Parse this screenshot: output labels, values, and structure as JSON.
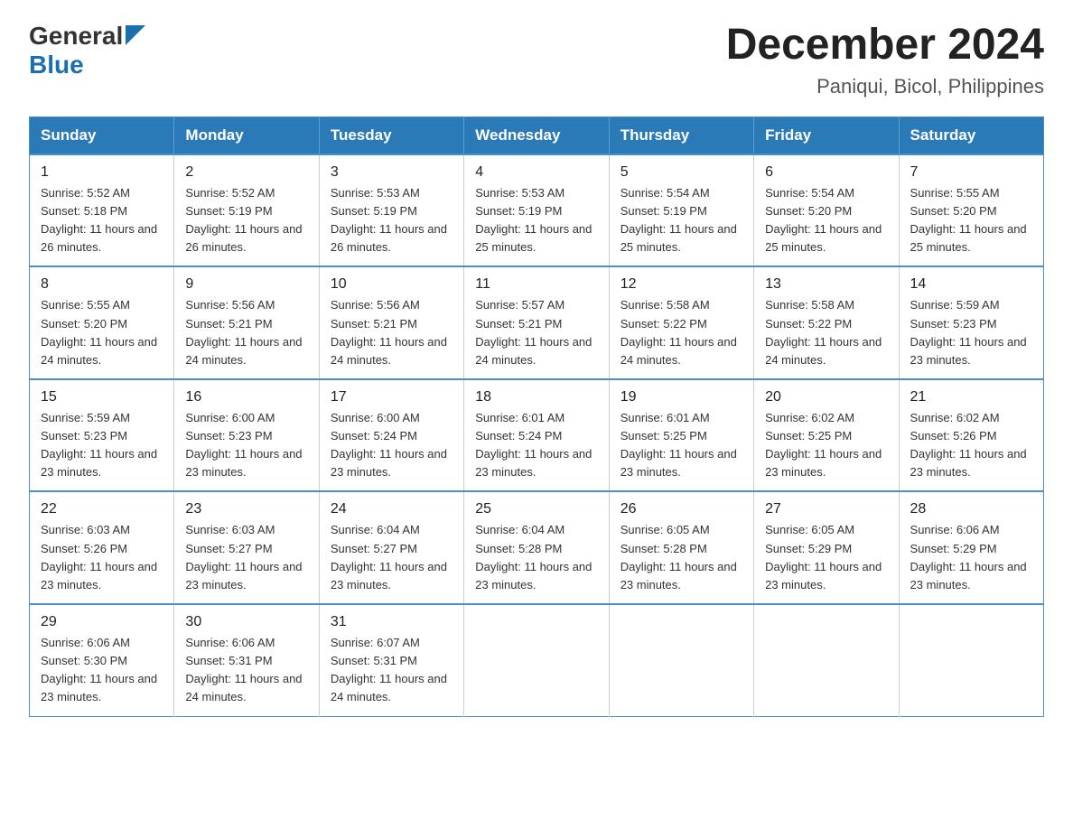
{
  "logo": {
    "general": "General",
    "blue": "Blue"
  },
  "title": "December 2024",
  "location": "Paniqui, Bicol, Philippines",
  "days_of_week": [
    "Sunday",
    "Monday",
    "Tuesday",
    "Wednesday",
    "Thursday",
    "Friday",
    "Saturday"
  ],
  "weeks": [
    [
      {
        "day": "1",
        "sunrise": "5:52 AM",
        "sunset": "5:18 PM",
        "daylight": "11 hours and 26 minutes."
      },
      {
        "day": "2",
        "sunrise": "5:52 AM",
        "sunset": "5:19 PM",
        "daylight": "11 hours and 26 minutes."
      },
      {
        "day": "3",
        "sunrise": "5:53 AM",
        "sunset": "5:19 PM",
        "daylight": "11 hours and 26 minutes."
      },
      {
        "day": "4",
        "sunrise": "5:53 AM",
        "sunset": "5:19 PM",
        "daylight": "11 hours and 25 minutes."
      },
      {
        "day": "5",
        "sunrise": "5:54 AM",
        "sunset": "5:19 PM",
        "daylight": "11 hours and 25 minutes."
      },
      {
        "day": "6",
        "sunrise": "5:54 AM",
        "sunset": "5:20 PM",
        "daylight": "11 hours and 25 minutes."
      },
      {
        "day": "7",
        "sunrise": "5:55 AM",
        "sunset": "5:20 PM",
        "daylight": "11 hours and 25 minutes."
      }
    ],
    [
      {
        "day": "8",
        "sunrise": "5:55 AM",
        "sunset": "5:20 PM",
        "daylight": "11 hours and 24 minutes."
      },
      {
        "day": "9",
        "sunrise": "5:56 AM",
        "sunset": "5:21 PM",
        "daylight": "11 hours and 24 minutes."
      },
      {
        "day": "10",
        "sunrise": "5:56 AM",
        "sunset": "5:21 PM",
        "daylight": "11 hours and 24 minutes."
      },
      {
        "day": "11",
        "sunrise": "5:57 AM",
        "sunset": "5:21 PM",
        "daylight": "11 hours and 24 minutes."
      },
      {
        "day": "12",
        "sunrise": "5:58 AM",
        "sunset": "5:22 PM",
        "daylight": "11 hours and 24 minutes."
      },
      {
        "day": "13",
        "sunrise": "5:58 AM",
        "sunset": "5:22 PM",
        "daylight": "11 hours and 24 minutes."
      },
      {
        "day": "14",
        "sunrise": "5:59 AM",
        "sunset": "5:23 PM",
        "daylight": "11 hours and 23 minutes."
      }
    ],
    [
      {
        "day": "15",
        "sunrise": "5:59 AM",
        "sunset": "5:23 PM",
        "daylight": "11 hours and 23 minutes."
      },
      {
        "day": "16",
        "sunrise": "6:00 AM",
        "sunset": "5:23 PM",
        "daylight": "11 hours and 23 minutes."
      },
      {
        "day": "17",
        "sunrise": "6:00 AM",
        "sunset": "5:24 PM",
        "daylight": "11 hours and 23 minutes."
      },
      {
        "day": "18",
        "sunrise": "6:01 AM",
        "sunset": "5:24 PM",
        "daylight": "11 hours and 23 minutes."
      },
      {
        "day": "19",
        "sunrise": "6:01 AM",
        "sunset": "5:25 PM",
        "daylight": "11 hours and 23 minutes."
      },
      {
        "day": "20",
        "sunrise": "6:02 AM",
        "sunset": "5:25 PM",
        "daylight": "11 hours and 23 minutes."
      },
      {
        "day": "21",
        "sunrise": "6:02 AM",
        "sunset": "5:26 PM",
        "daylight": "11 hours and 23 minutes."
      }
    ],
    [
      {
        "day": "22",
        "sunrise": "6:03 AM",
        "sunset": "5:26 PM",
        "daylight": "11 hours and 23 minutes."
      },
      {
        "day": "23",
        "sunrise": "6:03 AM",
        "sunset": "5:27 PM",
        "daylight": "11 hours and 23 minutes."
      },
      {
        "day": "24",
        "sunrise": "6:04 AM",
        "sunset": "5:27 PM",
        "daylight": "11 hours and 23 minutes."
      },
      {
        "day": "25",
        "sunrise": "6:04 AM",
        "sunset": "5:28 PM",
        "daylight": "11 hours and 23 minutes."
      },
      {
        "day": "26",
        "sunrise": "6:05 AM",
        "sunset": "5:28 PM",
        "daylight": "11 hours and 23 minutes."
      },
      {
        "day": "27",
        "sunrise": "6:05 AM",
        "sunset": "5:29 PM",
        "daylight": "11 hours and 23 minutes."
      },
      {
        "day": "28",
        "sunrise": "6:06 AM",
        "sunset": "5:29 PM",
        "daylight": "11 hours and 23 minutes."
      }
    ],
    [
      {
        "day": "29",
        "sunrise": "6:06 AM",
        "sunset": "5:30 PM",
        "daylight": "11 hours and 23 minutes."
      },
      {
        "day": "30",
        "sunrise": "6:06 AM",
        "sunset": "5:31 PM",
        "daylight": "11 hours and 24 minutes."
      },
      {
        "day": "31",
        "sunrise": "6:07 AM",
        "sunset": "5:31 PM",
        "daylight": "11 hours and 24 minutes."
      },
      null,
      null,
      null,
      null
    ]
  ]
}
